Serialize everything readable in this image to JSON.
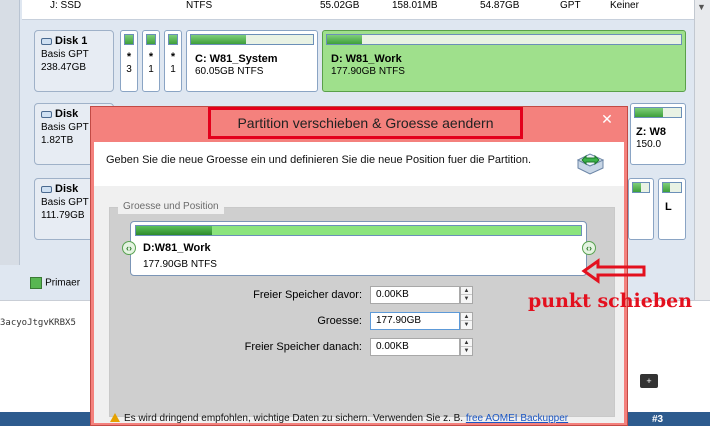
{
  "top_row": {
    "drive": "J: SSD",
    "fs": "NTFS",
    "capacity": "55.02GB",
    "used": "158.01MB",
    "unused": "54.87GB",
    "type": "GPT",
    "status": "Keiner"
  },
  "disks": [
    {
      "name": "Disk 1",
      "type": "Basis GPT",
      "size": "238.47GB"
    },
    {
      "name": "Disk",
      "type": "Basis GPT",
      "size": "1.82TB"
    },
    {
      "name": "Disk",
      "type": "Basis GPT",
      "size": "111.79GB"
    }
  ],
  "disk1_partitions": {
    "small": [
      "*",
      "*",
      "*"
    ],
    "small_num": [
      "3",
      "1",
      "1"
    ],
    "system": {
      "name": "C: W81_System",
      "info": "60.05GB NTFS",
      "fill": 0.45
    },
    "work": {
      "name": "D: W81_Work",
      "info": "177.90GB NTFS",
      "fill": 0.1
    }
  },
  "disk2_right": {
    "name": "Z: W8",
    "info": "150.0"
  },
  "disk3_right": {
    "name": "L"
  },
  "legend": {
    "label": "Primaer"
  },
  "code_text": "3acyoJtgvKRBX5",
  "dialog": {
    "title": "Partition verschieben & Groesse aendern",
    "close": "✕",
    "description": "Geben Sie die neue Groesse ein und definieren Sie die neue Position fuer die Partition.",
    "group_title": "Groesse und Position",
    "partition": {
      "name": "D:W81_Work",
      "info": "177.90GB NTFS",
      "fill": 0.17
    },
    "fields": {
      "before_label": "Freier Speicher davor:",
      "before_value": "0.00KB",
      "size_label": "Groesse:",
      "size_value": "177.90GB",
      "after_label": "Freier Speicher danach:",
      "after_value": "0.00KB"
    },
    "warning": {
      "text": "Es wird dringend empfohlen, wichtige Daten zu sichern. Verwenden Sie z. B. ",
      "link": "free AOMEI Backupper"
    }
  },
  "annotation": {
    "text": "punkt schieben"
  },
  "badge": "#3",
  "colors": {
    "annotation": "#e3101e",
    "dialog_border": "#f4817d",
    "partition_green": "#9fe08c"
  }
}
